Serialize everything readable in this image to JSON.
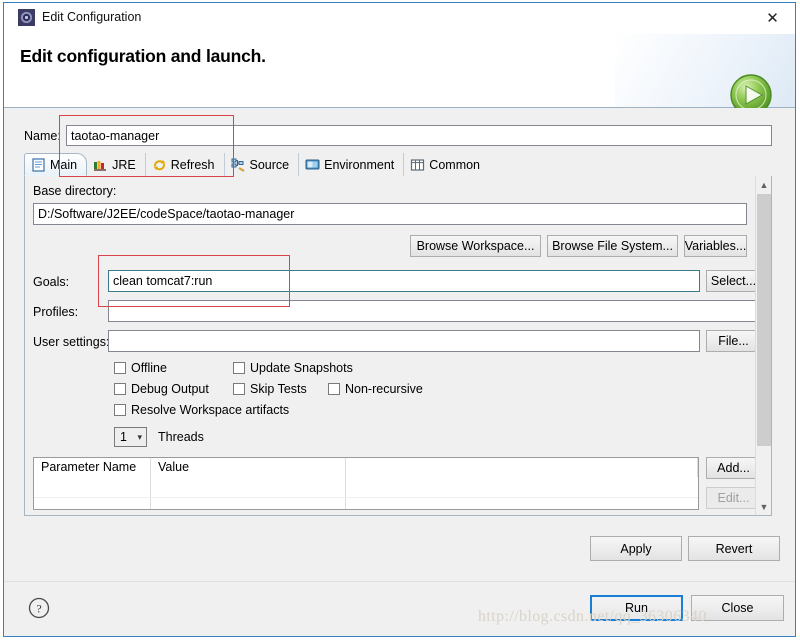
{
  "window": {
    "title": "Edit Configuration",
    "title_icon": "configuration-gear-icon",
    "close_label": "✕"
  },
  "header": {
    "title": "Edit configuration and launch.",
    "run_icon": "green-play-circle-icon"
  },
  "name_row": {
    "label": "Name:",
    "value": "taotao-manager"
  },
  "tabs": [
    {
      "label": "Main",
      "icon": "document-icon",
      "active": true
    },
    {
      "label": "JRE",
      "icon": "books-icon",
      "active": false
    },
    {
      "label": "Refresh",
      "icon": "refresh-arrows-icon",
      "active": false
    },
    {
      "label": "Source",
      "icon": "source-tree-icon",
      "active": false
    },
    {
      "label": "Environment",
      "icon": "environment-icon",
      "active": false
    },
    {
      "label": "Common",
      "icon": "common-table-icon",
      "active": false
    }
  ],
  "main_tab": {
    "base_directory_label": "Base directory:",
    "base_directory_value": "D:/Software/J2EE/codeSpace/taotao-manager",
    "browse_workspace_label": "Browse Workspace...",
    "browse_filesystem_label": "Browse File System...",
    "variables_label": "Variables...",
    "goals_label": "Goals:",
    "goals_value": "clean tomcat7:run",
    "select_label": "Select...",
    "profiles_label": "Profiles:",
    "profiles_value": "",
    "user_settings_label": "User settings:",
    "user_settings_value": "",
    "file_label": "File...",
    "checkboxes": [
      {
        "label": "Offline",
        "checked": false
      },
      {
        "label": "Update Snapshots",
        "checked": false
      },
      {
        "label": "Debug Output",
        "checked": false
      },
      {
        "label": "Skip Tests",
        "checked": false
      },
      {
        "label": "Non-recursive",
        "checked": false
      },
      {
        "label": "Resolve Workspace artifacts",
        "checked": false
      }
    ],
    "threads_value": "1",
    "threads_label": "Threads",
    "parameter_table": {
      "columns": [
        "Parameter Name",
        "Value",
        ""
      ],
      "rows": []
    },
    "add_label": "Add...",
    "edit_label": "Edit...",
    "edit_disabled": true
  },
  "action_bar": {
    "apply_label": "Apply",
    "revert_label": "Revert"
  },
  "footer": {
    "help_icon": "question-mark-icon",
    "run_label": "Run",
    "close_label": "Close"
  },
  "watermark": "http://blog.csdn.net/qq_36306340",
  "colors": {
    "accent_blue": "#1a7fd4",
    "dialog_border": "#3a7fc1",
    "annotation_red": "#d9444a",
    "panel_bg": "#f0f0f0",
    "field_focus": "#3c7a8c"
  }
}
